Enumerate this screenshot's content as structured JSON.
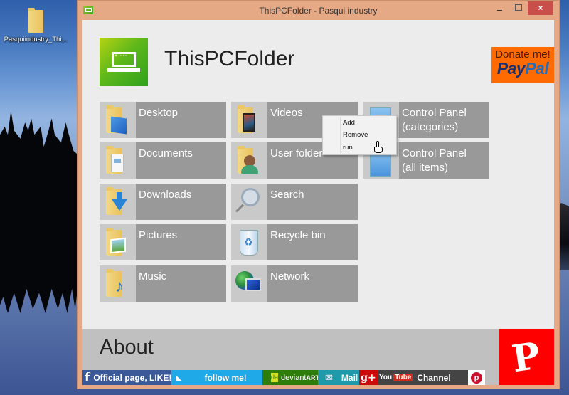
{
  "desktop": {
    "icons": [
      {
        "label": "Pasquiindustry_Thi...",
        "icon": "folder-icon"
      }
    ]
  },
  "window": {
    "title": "ThisPCFolder - Pasqui industry",
    "controls": {
      "minimize": "minimize",
      "maximize": "maximize",
      "close": "×"
    }
  },
  "header": {
    "app_title": "ThisPCFolder",
    "donate": {
      "line1": "Donate me!",
      "pay": "Pay",
      "pal": "Pal"
    }
  },
  "tiles": [
    {
      "label": "Desktop",
      "icon": "desktop-folder-icon"
    },
    {
      "label": "Documents",
      "icon": "documents-folder-icon"
    },
    {
      "label": "Downloads",
      "icon": "downloads-folder-icon"
    },
    {
      "label": "Pictures",
      "icon": "pictures-folder-icon"
    },
    {
      "label": "Music",
      "icon": "music-folder-icon"
    },
    {
      "label": "Videos",
      "icon": "videos-folder-icon"
    },
    {
      "label": "User folder",
      "icon": "user-folder-icon"
    },
    {
      "label": "Search",
      "icon": "search-icon"
    },
    {
      "label": "Recycle bin",
      "icon": "recycle-bin-icon"
    },
    {
      "label": "Network",
      "icon": "network-icon"
    },
    {
      "label": "Control Panel (categories)",
      "line1": "Control Panel",
      "line2": "(categories)",
      "icon": "control-panel-icon"
    },
    {
      "label": "Control Panel (all items)",
      "line1": "Control Panel",
      "line2": "(all items)",
      "icon": "control-panel-icon"
    }
  ],
  "context_menu": {
    "items": [
      "Add",
      "Remove",
      "run"
    ]
  },
  "about": {
    "title": "About",
    "logo_glyph": "P",
    "social": {
      "facebook": {
        "glyph": "f",
        "label": "Official page, LIKE!"
      },
      "twitter": {
        "glyph": "🐦",
        "label": "follow me!"
      },
      "deviantart": {
        "badge": "da",
        "label_a": "deviant",
        "label_b": "ART"
      },
      "mail": {
        "glyph": "✉",
        "label": "Mail"
      },
      "googleplus": {
        "label": "g+"
      },
      "youtube": {
        "you": "You",
        "tube": "Tube",
        "label": "Channel"
      },
      "pinterest": {
        "glyph": "p"
      }
    },
    "colors": {
      "facebook": "#3b5998",
      "twitter": "#1fa9e8",
      "deviantart": "#2e7d0b",
      "mail": "#1f9aaa",
      "googleplus": "#cc0a0a",
      "youtube": "#444444",
      "pasqui_red": "#ff0000"
    }
  },
  "colors": {
    "tile_bg": "#999999",
    "tile_icon_bg": "#c9c9c9",
    "window_frame": "#e6a986",
    "donate_bg": "#ff6b00",
    "close_button": "#c9504a"
  }
}
